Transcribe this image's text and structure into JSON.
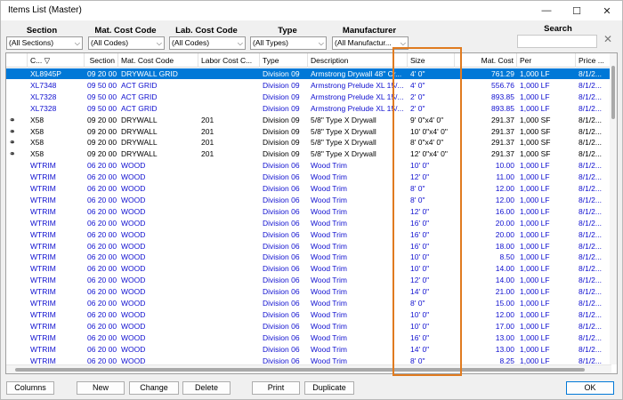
{
  "window": {
    "title": "Items List (Master)"
  },
  "filters": {
    "section": {
      "label": "Section",
      "value": "(All Sections)"
    },
    "mat_cost_code": {
      "label": "Mat. Cost Code",
      "value": "(All Codes)"
    },
    "lab_cost_code": {
      "label": "Lab. Cost Code",
      "value": "(All Codes)"
    },
    "type": {
      "label": "Type",
      "value": "(All Types)"
    },
    "manufacturer": {
      "label": "Manufacturer",
      "value": "(All Manufactur..."
    },
    "search": {
      "label": "Search",
      "value": ""
    }
  },
  "columns": [
    "C...",
    "Section",
    "Mat. Cost Code",
    "Labor Cost C...",
    "Type",
    "Description",
    "Size",
    "Mat. Cost",
    "Per",
    "Price ..."
  ],
  "rows": [
    {
      "style": "sel",
      "icon": "",
      "code": "XL8945P",
      "section": "09 20 00",
      "mat": "DRYWALL GRID",
      "lab": "",
      "type": "Division 09",
      "desc": "Armstrong Drywall 48\" Cr...",
      "size": "4' 0\"",
      "cost": "761.29",
      "per": "1,000 LF",
      "price": "8/1/2..."
    },
    {
      "style": "blue",
      "icon": "",
      "code": "XL7348",
      "section": "09 50 00",
      "mat": "ACT GRID",
      "lab": "",
      "type": "Division 09",
      "desc": "Armstrong Prelude XL 15/...",
      "size": "4' 0\"",
      "cost": "556.76",
      "per": "1,000 LF",
      "price": "8/1/2..."
    },
    {
      "style": "blue",
      "icon": "",
      "code": "XL7328",
      "section": "09 50 00",
      "mat": "ACT GRID",
      "lab": "",
      "type": "Division 09",
      "desc": "Armstrong Prelude XL 15/...",
      "size": "2' 0\"",
      "cost": "893.85",
      "per": "1,000 LF",
      "price": "8/1/2..."
    },
    {
      "style": "blue",
      "icon": "",
      "code": "XL7328",
      "section": "09 50 00",
      "mat": "ACT GRID",
      "lab": "",
      "type": "Division 09",
      "desc": "Armstrong Prelude XL 15/...",
      "size": "2' 0\"",
      "cost": "893.85",
      "per": "1,000 LF",
      "price": "8/1/2..."
    },
    {
      "style": "black",
      "icon": "link",
      "code": "X58",
      "section": "09 20 00",
      "mat": "DRYWALL",
      "lab": "201",
      "type": "Division 09",
      "desc": "5/8\" Type X Drywall",
      "size": "9' 0\"x4' 0\"",
      "cost": "291.37",
      "per": "1,000 SF",
      "price": "8/1/2..."
    },
    {
      "style": "black",
      "icon": "link",
      "code": "X58",
      "section": "09 20 00",
      "mat": "DRYWALL",
      "lab": "201",
      "type": "Division 09",
      "desc": "5/8\" Type X Drywall",
      "size": "10' 0\"x4' 0\"",
      "cost": "291.37",
      "per": "1,000 SF",
      "price": "8/1/2..."
    },
    {
      "style": "black",
      "icon": "link",
      "code": "X58",
      "section": "09 20 00",
      "mat": "DRYWALL",
      "lab": "201",
      "type": "Division 09",
      "desc": "5/8\" Type X Drywall",
      "size": "8' 0\"x4' 0\"",
      "cost": "291.37",
      "per": "1,000 SF",
      "price": "8/1/2..."
    },
    {
      "style": "black",
      "icon": "link",
      "code": "X58",
      "section": "09 20 00",
      "mat": "DRYWALL",
      "lab": "201",
      "type": "Division 09",
      "desc": "5/8\" Type X Drywall",
      "size": "12' 0\"x4' 0\"",
      "cost": "291.37",
      "per": "1,000 SF",
      "price": "8/1/2..."
    },
    {
      "style": "blue",
      "icon": "",
      "code": "WTRIM",
      "section": "06 20 00",
      "mat": "WOOD",
      "lab": "",
      "type": "Division 06",
      "desc": "Wood Trim",
      "size": "10' 0\"",
      "cost": "10.00",
      "per": "1,000 LF",
      "price": "8/1/2..."
    },
    {
      "style": "blue",
      "icon": "",
      "code": "WTRIM",
      "section": "06 20 00",
      "mat": "WOOD",
      "lab": "",
      "type": "Division 06",
      "desc": "Wood Trim",
      "size": "12' 0\"",
      "cost": "11.00",
      "per": "1,000 LF",
      "price": "8/1/2..."
    },
    {
      "style": "blue",
      "icon": "",
      "code": "WTRIM",
      "section": "06 20 00",
      "mat": "WOOD",
      "lab": "",
      "type": "Division 06",
      "desc": "Wood Trim",
      "size": "8' 0\"",
      "cost": "12.00",
      "per": "1,000 LF",
      "price": "8/1/2..."
    },
    {
      "style": "blue",
      "icon": "",
      "code": "WTRIM",
      "section": "06 20 00",
      "mat": "WOOD",
      "lab": "",
      "type": "Division 06",
      "desc": "Wood Trim",
      "size": "8' 0\"",
      "cost": "12.00",
      "per": "1,000 LF",
      "price": "8/1/2..."
    },
    {
      "style": "blue",
      "icon": "",
      "code": "WTRIM",
      "section": "06 20 00",
      "mat": "WOOD",
      "lab": "",
      "type": "Division 06",
      "desc": "Wood Trim",
      "size": "12' 0\"",
      "cost": "16.00",
      "per": "1,000 LF",
      "price": "8/1/2..."
    },
    {
      "style": "blue",
      "icon": "",
      "code": "WTRIM",
      "section": "06 20 00",
      "mat": "WOOD",
      "lab": "",
      "type": "Division 06",
      "desc": "Wood Trim",
      "size": "16' 0\"",
      "cost": "20.00",
      "per": "1,000 LF",
      "price": "8/1/2..."
    },
    {
      "style": "blue",
      "icon": "",
      "code": "WTRIM",
      "section": "06 20 00",
      "mat": "WOOD",
      "lab": "",
      "type": "Division 06",
      "desc": "Wood Trim",
      "size": "16' 0\"",
      "cost": "20.00",
      "per": "1,000 LF",
      "price": "8/1/2..."
    },
    {
      "style": "blue",
      "icon": "",
      "code": "WTRIM",
      "section": "06 20 00",
      "mat": "WOOD",
      "lab": "",
      "type": "Division 06",
      "desc": "Wood Trim",
      "size": "16' 0\"",
      "cost": "18.00",
      "per": "1,000 LF",
      "price": "8/1/2..."
    },
    {
      "style": "blue",
      "icon": "",
      "code": "WTRIM",
      "section": "06 20 00",
      "mat": "WOOD",
      "lab": "",
      "type": "Division 06",
      "desc": "Wood Trim",
      "size": "10' 0\"",
      "cost": "8.50",
      "per": "1,000 LF",
      "price": "8/1/2..."
    },
    {
      "style": "blue",
      "icon": "",
      "code": "WTRIM",
      "section": "06 20 00",
      "mat": "WOOD",
      "lab": "",
      "type": "Division 06",
      "desc": "Wood Trim",
      "size": "10' 0\"",
      "cost": "14.00",
      "per": "1,000 LF",
      "price": "8/1/2..."
    },
    {
      "style": "blue",
      "icon": "",
      "code": "WTRIM",
      "section": "06 20 00",
      "mat": "WOOD",
      "lab": "",
      "type": "Division 06",
      "desc": "Wood Trim",
      "size": "12' 0\"",
      "cost": "14.00",
      "per": "1,000 LF",
      "price": "8/1/2..."
    },
    {
      "style": "blue",
      "icon": "",
      "code": "WTRIM",
      "section": "06 20 00",
      "mat": "WOOD",
      "lab": "",
      "type": "Division 06",
      "desc": "Wood Trim",
      "size": "14' 0\"",
      "cost": "21.00",
      "per": "1,000 LF",
      "price": "8/1/2..."
    },
    {
      "style": "blue",
      "icon": "",
      "code": "WTRIM",
      "section": "06 20 00",
      "mat": "WOOD",
      "lab": "",
      "type": "Division 06",
      "desc": "Wood Trim",
      "size": "8' 0\"",
      "cost": "15.00",
      "per": "1,000 LF",
      "price": "8/1/2..."
    },
    {
      "style": "blue",
      "icon": "",
      "code": "WTRIM",
      "section": "06 20 00",
      "mat": "WOOD",
      "lab": "",
      "type": "Division 06",
      "desc": "Wood Trim",
      "size": "10' 0\"",
      "cost": "12.00",
      "per": "1,000 LF",
      "price": "8/1/2..."
    },
    {
      "style": "blue",
      "icon": "",
      "code": "WTRIM",
      "section": "06 20 00",
      "mat": "WOOD",
      "lab": "",
      "type": "Division 06",
      "desc": "Wood Trim",
      "size": "10' 0\"",
      "cost": "17.00",
      "per": "1,000 LF",
      "price": "8/1/2..."
    },
    {
      "style": "blue",
      "icon": "",
      "code": "WTRIM",
      "section": "06 20 00",
      "mat": "WOOD",
      "lab": "",
      "type": "Division 06",
      "desc": "Wood Trim",
      "size": "16' 0\"",
      "cost": "13.00",
      "per": "1,000 LF",
      "price": "8/1/2..."
    },
    {
      "style": "blue",
      "icon": "",
      "code": "WTRIM",
      "section": "06 20 00",
      "mat": "WOOD",
      "lab": "",
      "type": "Division 06",
      "desc": "Wood Trim",
      "size": "14' 0\"",
      "cost": "13.00",
      "per": "1,000 LF",
      "price": "8/1/2..."
    },
    {
      "style": "blue",
      "icon": "",
      "code": "WTRIM",
      "section": "06 20 00",
      "mat": "WOOD",
      "lab": "",
      "type": "Division 06",
      "desc": "Wood Trim",
      "size": "8' 0\"",
      "cost": "8.25",
      "per": "1,000 LF",
      "price": "8/1/2..."
    }
  ],
  "buttons": {
    "columns": "Columns",
    "new": "New",
    "change": "Change",
    "delete": "Delete",
    "print": "Print",
    "duplicate": "Duplicate",
    "ok": "OK"
  },
  "colors": {
    "selected_row": "#0078d7",
    "link_text": "#1010d0",
    "highlight_box": "#e07b20"
  }
}
